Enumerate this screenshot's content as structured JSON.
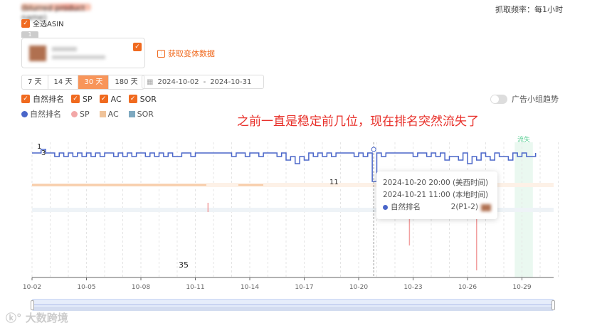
{
  "header": {
    "title": "(blurred product name)",
    "frequency_label": "抓取频率：",
    "frequency_value": "每1小时"
  },
  "asin": {
    "select_all_label": "全选ASIN",
    "card_index": "1",
    "fetch_variants_label": "获取变体数据"
  },
  "range": {
    "options": [
      "7 天",
      "14 天",
      "30 天",
      "180 天"
    ],
    "selected": "30 天",
    "start": "2024-10-02",
    "sep": "-",
    "end": "2024-10-31"
  },
  "filters": [
    {
      "label": "自然排名",
      "checked": true
    },
    {
      "label": "SP",
      "checked": true
    },
    {
      "label": "AC",
      "checked": true
    },
    {
      "label": "SOR",
      "checked": true
    }
  ],
  "ad_toggle": {
    "label": "广告小组趋势",
    "on": false
  },
  "legend": [
    {
      "label": "自然排名",
      "color": "#4a66c9"
    },
    {
      "label": "SP",
      "color": "#f2a7a7"
    },
    {
      "label": "AC",
      "color": "#efc39a"
    },
    {
      "label": "SOR",
      "color": "#7ea9c0"
    }
  ],
  "annotation": "之前一直是稳定前几位，现在排名突然流失了",
  "chart_data": {
    "type": "line",
    "x_start": "2024-10-02",
    "x_end": "2024-10-31",
    "x_step_hours": 6,
    "xticks": [
      "10-02",
      "10-05",
      "10-08",
      "10-11",
      "10-14",
      "10-17",
      "10-20",
      "10-23",
      "10-26",
      "10-29"
    ],
    "y_inverted": true,
    "ylim": [
      1,
      38
    ],
    "labels": {
      "max": "1",
      "start": "3",
      "peak": "11",
      "min": "35"
    },
    "lost_label": "流失",
    "lost_range_days": [
      26.6,
      27.6
    ],
    "series": [
      {
        "name": "自然排名",
        "color": "#4a66c9",
        "values": [
          3,
          3,
          2,
          3,
          3,
          4,
          3,
          4,
          3,
          4,
          3,
          4,
          3,
          4,
          3,
          4,
          3,
          3,
          4,
          3,
          4,
          3,
          4,
          3,
          3,
          4,
          3,
          4,
          3,
          4,
          3,
          4,
          4,
          3,
          3,
          4,
          3,
          3,
          3,
          3,
          3,
          3,
          3,
          3,
          4,
          3,
          3,
          4,
          3,
          3,
          4,
          3,
          3,
          3,
          4,
          3,
          5,
          4,
          6,
          4,
          5,
          3,
          4,
          3,
          4,
          3,
          4,
          3,
          3,
          3,
          3,
          4,
          3,
          4,
          3,
          11,
          3,
          4,
          3,
          3,
          3,
          3,
          3,
          3,
          4,
          3,
          3,
          4,
          3,
          4,
          3,
          5,
          4,
          4,
          5,
          3,
          6,
          4,
          5,
          3,
          4,
          5,
          3,
          4,
          4,
          5,
          3,
          4,
          3,
          4,
          4,
          3
        ]
      }
    ],
    "sp_spikes": [
      {
        "day": 9.7,
        "rank": 17
      },
      {
        "day": 20.8,
        "rank": 29
      },
      {
        "day": 24.5,
        "rank": 36
      }
    ],
    "ac_rank": 12,
    "sor_rank": 19
  },
  "tooltip": {
    "time_us": "2024-10-20 20:00 (美西时间)",
    "time_local": "2024-10-21 11:00 (本地时间)",
    "series": "自然排名",
    "value": "2(P1-2)"
  },
  "brand": "大数跨境"
}
